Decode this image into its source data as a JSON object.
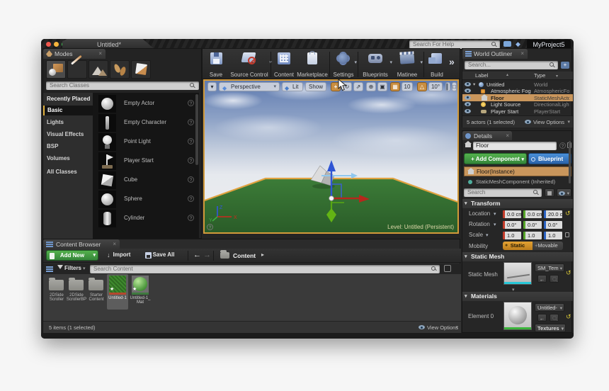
{
  "window": {
    "tab_title": "Untitled*",
    "project_name": "MyProject5",
    "help_search_placeholder": "Search For Help"
  },
  "icons": {
    "caret_down": "▾",
    "caret_right": "▸",
    "caret_up": "▴",
    "close": "×",
    "overflow": "»",
    "back": "←",
    "forward": "→",
    "reset": "↺",
    "star": "★",
    "question": "?",
    "plus": "+",
    "rotate": "↻",
    "scale_arrow": "⇗",
    "globe": "⊕",
    "grid": "▦",
    "angle": "△",
    "snap": "▣",
    "maximize": "□",
    "camera": "▌",
    "diamond": "◆",
    "import_arrow": "↓",
    "dot": "●"
  },
  "modes_panel": {
    "tab": "Modes",
    "search_placeholder": "Search Classes",
    "categories": [
      {
        "label": "Recently Placed",
        "selected": false
      },
      {
        "label": "Basic",
        "selected": true
      },
      {
        "label": "Lights",
        "selected": false
      },
      {
        "label": "Visual Effects",
        "selected": false
      },
      {
        "label": "BSP",
        "selected": false
      },
      {
        "label": "Volumes",
        "selected": false
      },
      {
        "label": "All Classes",
        "selected": false
      }
    ],
    "classes": [
      "Empty Actor",
      "Empty Character",
      "Point Light",
      "Player Start",
      "Cube",
      "Sphere",
      "Cylinder"
    ]
  },
  "main_toolbar": {
    "buttons": [
      "Save",
      "Source Control",
      "Content",
      "Marketplace",
      "Settings",
      "Blueprints",
      "Matinee",
      "Build"
    ]
  },
  "viewport": {
    "perspective": "Perspective",
    "lit": "Lit",
    "show": "Show",
    "grid_snap_value": "10",
    "angle_snap_value": "10°",
    "level_label": "Level:  Untitled (Persistent)",
    "axis": {
      "x": "X",
      "y": "Y",
      "z": "Z"
    }
  },
  "world_outliner": {
    "tab": "World Outliner",
    "search_placeholder": "Search...",
    "columns": {
      "label": "Label",
      "type": "Type"
    },
    "rows": [
      {
        "label": "Untitled",
        "type": "World",
        "selected": false
      },
      {
        "label": "Atmospheric Fog",
        "type": "AtmosphericFog",
        "selected": false
      },
      {
        "label": "Floor",
        "type": "StaticMeshActor",
        "selected": true
      },
      {
        "label": "Light Source",
        "type": "DirectionalLight",
        "selected": false
      },
      {
        "label": "Player Start",
        "type": "PlayerStart",
        "selected": false
      }
    ],
    "footer": "5 actors (1 selected)",
    "view_options": "View Options"
  },
  "details": {
    "tab": "Details",
    "actor_name": "Floor",
    "add_component": "+ Add Component",
    "blueprint": "Blueprint",
    "component_rows": [
      "Floor(Instance)",
      "StaticMeshComponent (Inherited)"
    ],
    "search_placeholder": "Search",
    "transform": {
      "section": "Transform",
      "location": {
        "label": "Location",
        "x": "0.0 cm",
        "y": "0.0 cm",
        "z": "20.0 cm"
      },
      "rotation": {
        "label": "Rotation",
        "x": "0.0°",
        "y": "0.0°",
        "z": "0.0°"
      },
      "scale": {
        "label": "Scale",
        "x": "1.0",
        "y": "1.0",
        "z": "1.0"
      },
      "mobility": {
        "label": "Mobility",
        "options": [
          "Static",
          "Movable"
        ],
        "selected": "Static"
      }
    },
    "static_mesh": {
      "section": "Static Mesh",
      "label": "Static Mesh",
      "asset": "SM_Tem"
    },
    "materials": {
      "section": "Materials",
      "element_label": "Element 0",
      "asset": "Untitled-",
      "textures_button": "Textures"
    }
  },
  "content_browser": {
    "tab": "Content Browser",
    "add_new": "Add New",
    "import": "Import",
    "save_all": "Save All",
    "path": "Content",
    "filters": "Filters",
    "search_placeholder": "Search Content",
    "items": [
      {
        "name": "2DSide Scroller",
        "kind": "folder",
        "selected": false
      },
      {
        "name": "2DSide ScrollerBP",
        "kind": "folder",
        "selected": false
      },
      {
        "name": "Starter Content",
        "kind": "folder",
        "selected": false
      },
      {
        "name": "Untitled-1",
        "kind": "texture",
        "selected": true
      },
      {
        "name": "Untitled-1_ Mat",
        "kind": "material",
        "selected": false
      }
    ],
    "status": "5 items (1 selected)",
    "view_options": "View Options"
  },
  "colors": {
    "selection_orange": "#c9965c",
    "viewport_border": "#d29a3a",
    "accent_green": "#3fa23c",
    "accent_blue": "#3272b6",
    "axis_x": "#cc2a1e",
    "axis_y": "#3fae3f",
    "axis_z": "#3355e0",
    "mobility_static": "#cf8b28"
  }
}
